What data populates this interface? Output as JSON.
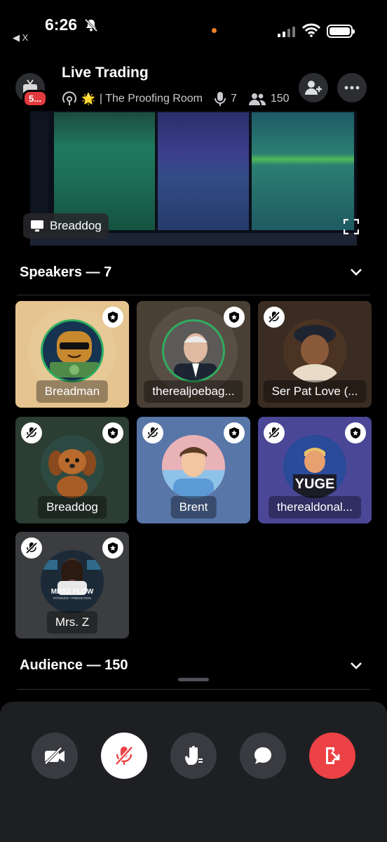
{
  "status": {
    "time": "6:26",
    "back_label": "◀ X"
  },
  "header": {
    "badge": "5...",
    "title": "Live Trading",
    "star": "🌟",
    "room": "| The Proofing Room",
    "speakers_count": "7",
    "listeners_count": "150"
  },
  "share": {
    "label": "Breaddog"
  },
  "speakers": {
    "heading": "Speakers — 7",
    "tiles": [
      {
        "name": "Breadman",
        "color": "#e5c48f"
      },
      {
        "name": "therealjoebag...",
        "color": "#4a3f35"
      },
      {
        "name": "Ser Pat Love (...",
        "color": "#3a2c22"
      },
      {
        "name": "Breaddog",
        "color": "#2c3d33"
      },
      {
        "name": "Brent",
        "color": "#5876a8"
      },
      {
        "name": "therealdonal...",
        "color": "#4b4797"
      },
      {
        "name": "Mrs. Z",
        "color": "#3b3d40"
      }
    ],
    "yuge": "YUGE",
    "mrsz_line1": "MRSZ FLOW",
    "mrsz_line2": "PATIENCE • PREDICTION"
  },
  "audience": {
    "heading": "Audience — 150"
  },
  "colors": {
    "leave": "#ed4245",
    "active_mic": "#ffffff",
    "ctrl": "#3a3b40"
  }
}
